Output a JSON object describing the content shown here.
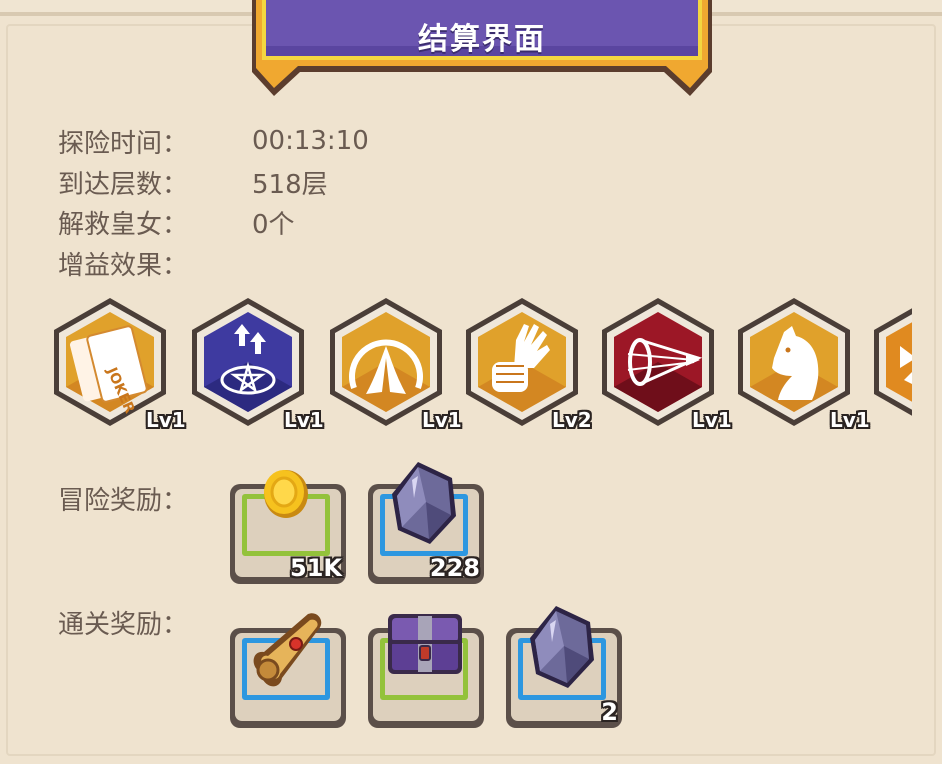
{
  "title": "结算界面",
  "stats": [
    {
      "label": "探险时间：",
      "value": "00:13:10"
    },
    {
      "label": "到达层数：",
      "value": "518层"
    },
    {
      "label": "解救皇女：",
      "value": "0个"
    },
    {
      "label": "增益效果：",
      "value": ""
    }
  ],
  "buffs": [
    {
      "icon": "joker-card-icon",
      "level": "Lv1",
      "color": "#e0a12b"
    },
    {
      "icon": "pentagram-arrows-icon",
      "level": "Lv1",
      "color": "#3e3aa0"
    },
    {
      "icon": "praying-hands-icon",
      "level": "Lv1",
      "color": "#e0a12b"
    },
    {
      "icon": "fist-hand-icon",
      "level": "Lv2",
      "color": "#e0a12b"
    },
    {
      "icon": "speed-dash-icon",
      "level": "Lv1",
      "color": "#9c1726"
    },
    {
      "icon": "horse-head-icon",
      "level": "Lv1",
      "color": "#e0a12b"
    },
    {
      "icon": "partial-buff-icon",
      "level": "",
      "color": "#e08a20"
    }
  ],
  "adventure_rewards": {
    "label": "冒险奖励：",
    "items": [
      {
        "icon": "gold-coin-icon",
        "qty": "51K",
        "frame": "green"
      },
      {
        "icon": "crystal-icon",
        "qty": "228",
        "frame": "blue"
      }
    ]
  },
  "clear_rewards": {
    "label": "通关奖励：",
    "items": [
      {
        "icon": "scroll-icon",
        "qty": "",
        "frame": "blue"
      },
      {
        "icon": "treasure-chest-icon",
        "qty": "",
        "frame": "green"
      },
      {
        "icon": "crystal-icon",
        "qty": "2",
        "frame": "blue"
      }
    ]
  },
  "colors": {
    "banner": "#6b55b0",
    "banner_border": "#f0c930",
    "panel": "#efe3cf",
    "text": "#6a5b51"
  }
}
